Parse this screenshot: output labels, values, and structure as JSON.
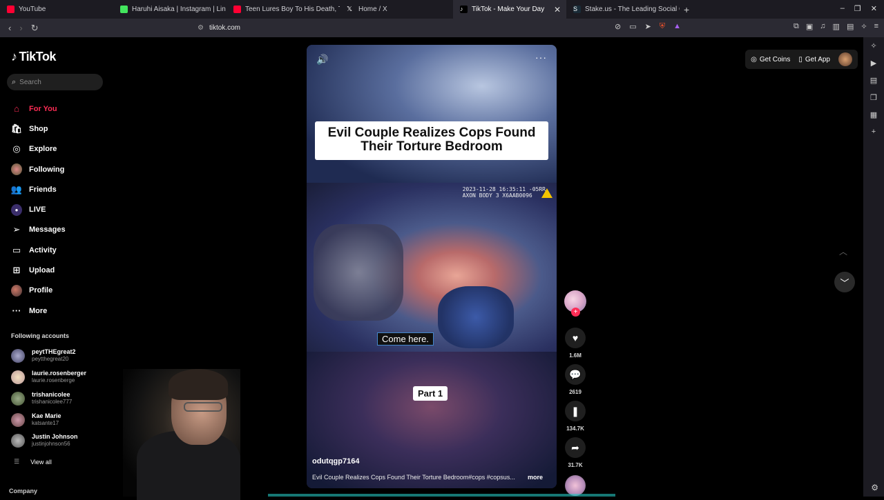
{
  "browser": {
    "tabs": [
      {
        "title": "YouTube",
        "favicon_color": "#ff0033",
        "active": false
      },
      {
        "title": "Haruhi Aisaka | Instagram | Lin",
        "favicon_color": "#43e55e",
        "active": false
      },
      {
        "title": "Teen Lures Boy To His Death, Th",
        "favicon_color": "#ff0033",
        "active": false
      },
      {
        "title": "Home / X",
        "favicon_color": "#000000",
        "active": false
      },
      {
        "title": "TikTok - Make Your Day",
        "favicon_color": "#000000",
        "active": true
      },
      {
        "title": "Stake.us - The Leading Social Ca",
        "favicon_color": "#1a2c38",
        "active": false
      }
    ],
    "url": "tiktok.com"
  },
  "app": {
    "logo_text": "TikTok",
    "search_placeholder": "Search",
    "nav": [
      {
        "label": "For You",
        "icon": "home-icon",
        "active": true
      },
      {
        "label": "Shop",
        "icon": "shop-icon",
        "active": false
      },
      {
        "label": "Explore",
        "icon": "compass-icon",
        "active": false
      },
      {
        "label": "Following",
        "icon": "following-avatar-icon",
        "active": false
      },
      {
        "label": "Friends",
        "icon": "friends-icon",
        "active": false
      },
      {
        "label": "LIVE",
        "icon": "live-icon",
        "active": false
      },
      {
        "label": "Messages",
        "icon": "messages-icon",
        "active": false
      },
      {
        "label": "Activity",
        "icon": "activity-icon",
        "active": false
      },
      {
        "label": "Upload",
        "icon": "upload-icon",
        "active": false
      },
      {
        "label": "Profile",
        "icon": "profile-avatar-icon",
        "active": false
      },
      {
        "label": "More",
        "icon": "more-icon",
        "active": false
      }
    ],
    "following_header": "Following accounts",
    "following_accounts": [
      {
        "name": "peytTHEgreat2",
        "handle": "peytthegreat20"
      },
      {
        "name": "laurie.rosenberger",
        "handle": "laurie.rosenberge"
      },
      {
        "name": "trishanicolee",
        "handle": "trishanicolee777"
      },
      {
        "name": "Kae Marie",
        "handle": "katsante17"
      },
      {
        "name": "Justin Johnson",
        "handle": "justinjohnson56"
      }
    ],
    "view_all": "View all",
    "company": "Company",
    "top_right": {
      "get_coins": "Get Coins",
      "get_app": "Get App"
    }
  },
  "video": {
    "overlay_title": "Evil Couple Realizes Cops Found Their Torture Bedroom",
    "bodycam_stamp_line1": "2023-11-28 16:35:11 -05RR",
    "bodycam_stamp_line2": "AXON BODY 3 X6AAB0096",
    "subtitle": "Come here.",
    "part_label": "Part 1",
    "username": "odutqgp7164",
    "description": "Evil Couple Realizes Cops Found Their Torture Bedroom#cops #copsus...",
    "more_label": "more",
    "likes": "1.6M",
    "comments": "2619",
    "bookmarks": "134.7K",
    "shares": "31.7K"
  },
  "colors": {
    "accent": "#fe2c55",
    "progress": "#24c7c1"
  }
}
